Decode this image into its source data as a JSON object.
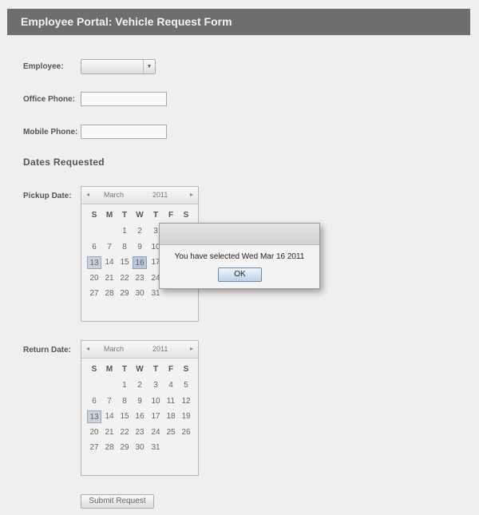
{
  "header": {
    "title": "Employee Portal: Vehicle Request Form"
  },
  "form": {
    "employee_label": "Employee:",
    "employee_value": "",
    "office_phone_label": "Office Phone:",
    "office_phone_value": "",
    "mobile_phone_label": "Mobile Phone:",
    "mobile_phone_value": "",
    "dates_section_title": "Dates Requested",
    "pickup_label": "Pickup Date:",
    "return_label": "Return Date:",
    "submit_label": "Submit Request"
  },
  "calendar_common": {
    "weekdays": [
      "S",
      "M",
      "T",
      "W",
      "T",
      "F",
      "S"
    ],
    "prev_icon": "◂",
    "next_icon": "▸"
  },
  "pickup_calendar": {
    "month": "March",
    "year": "2011",
    "today": "13",
    "selected": "16",
    "weeks": [
      [
        "",
        "",
        "1",
        "2",
        "3",
        "",
        ""
      ],
      [
        "6",
        "7",
        "8",
        "9",
        "10",
        "",
        ""
      ],
      [
        "13",
        "14",
        "15",
        "16",
        "17",
        "",
        ""
      ],
      [
        "20",
        "21",
        "22",
        "23",
        "24",
        "",
        ""
      ],
      [
        "27",
        "28",
        "29",
        "30",
        "31",
        "",
        ""
      ]
    ]
  },
  "return_calendar": {
    "month": "March",
    "year": "2011",
    "today": "13",
    "weeks": [
      [
        "",
        "",
        "1",
        "2",
        "3",
        "4",
        "5"
      ],
      [
        "6",
        "7",
        "8",
        "9",
        "10",
        "11",
        "12"
      ],
      [
        "13",
        "14",
        "15",
        "16",
        "17",
        "18",
        "19"
      ],
      [
        "20",
        "21",
        "22",
        "23",
        "24",
        "25",
        "26"
      ],
      [
        "27",
        "28",
        "29",
        "30",
        "31",
        "",
        ""
      ]
    ]
  },
  "dialog": {
    "message": "You have selected Wed Mar 16 2011",
    "ok_label": "OK"
  }
}
